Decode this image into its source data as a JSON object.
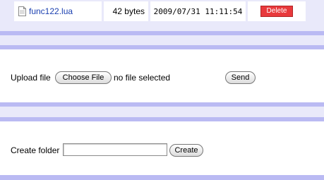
{
  "file_row": {
    "file_name": "func122.lua",
    "file_icon": "document-icon",
    "size": "42 bytes",
    "modified": "2009/07/31 11:11:54",
    "delete_label": "Delete",
    "delete_color": "#e8393c",
    "link_color": "#1a3fb0"
  },
  "upload": {
    "label": "Upload file",
    "choose_label": "Choose File",
    "status": "no file selected",
    "send_label": "Send"
  },
  "create": {
    "label": "Create folder",
    "input_value": "",
    "button_label": "Create"
  },
  "colors": {
    "background": "#e9e9fa",
    "band": "#babaf3",
    "panel": "#ffffff"
  }
}
